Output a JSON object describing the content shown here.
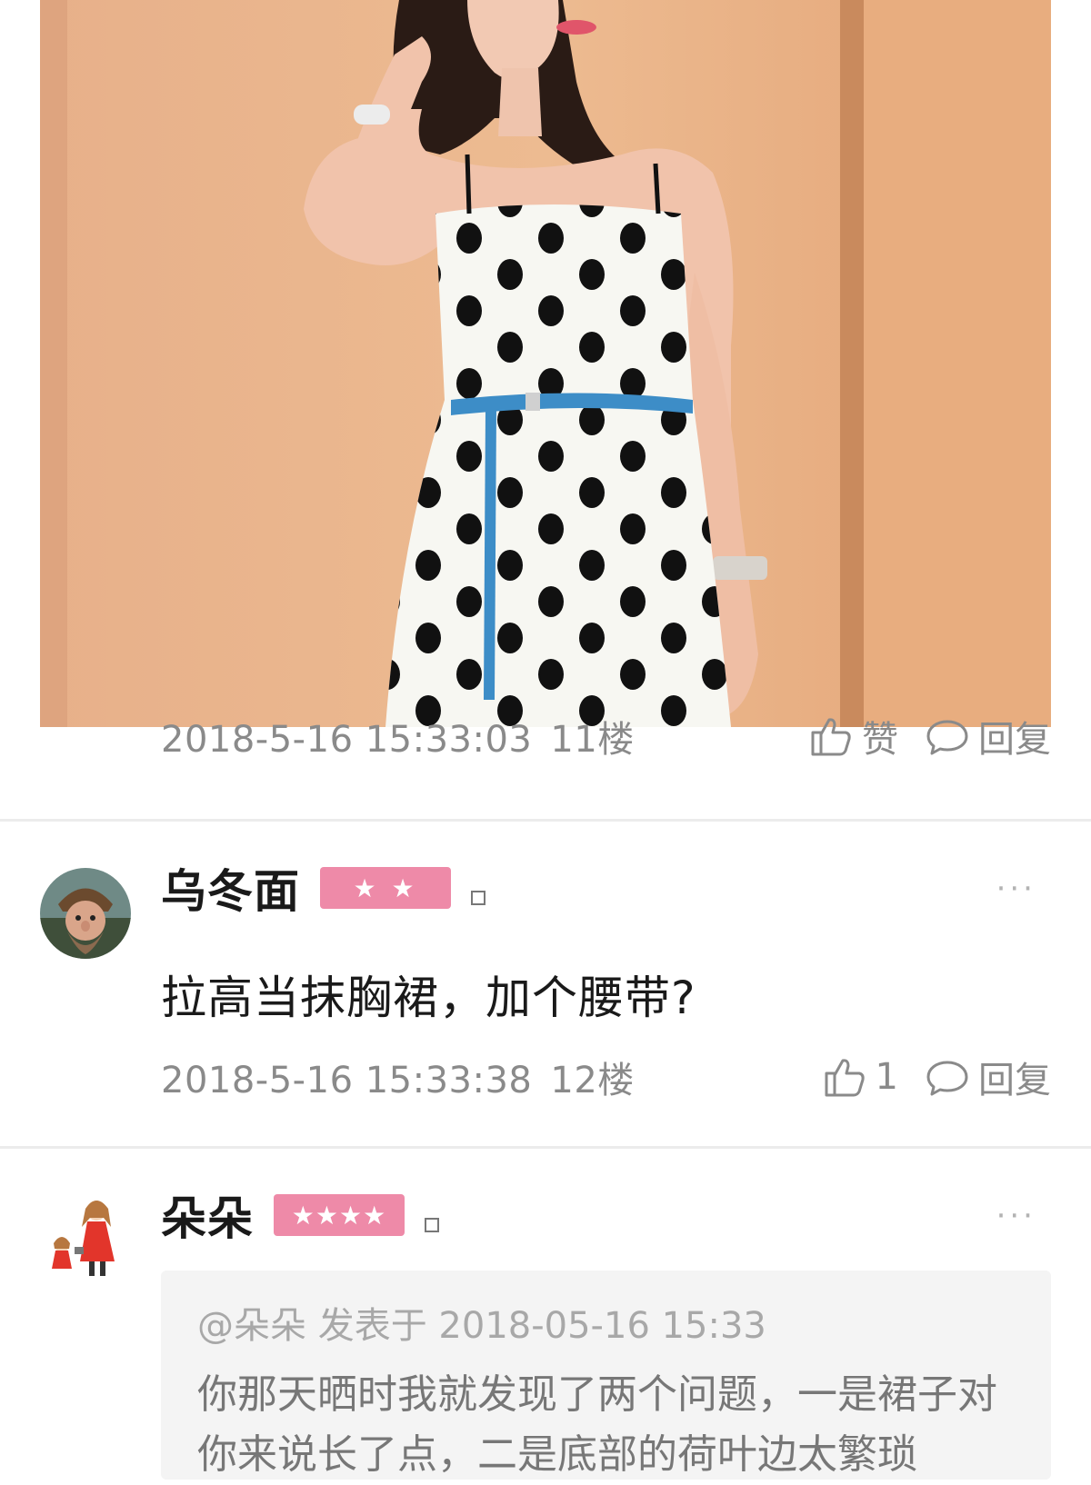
{
  "post_11": {
    "timestamp": "2018-5-16 15:33:03",
    "floor": "11楼",
    "like_label": "赞",
    "reply_label": "回复"
  },
  "comment_12": {
    "username": "乌冬面",
    "level_badge": "★ ★",
    "text": "拉高当抹胸裙，加个腰带?",
    "timestamp": "2018-5-16 15:33:38",
    "floor": "12楼",
    "like_count": "1",
    "reply_label": "回复",
    "more": "···"
  },
  "comment_13": {
    "username": "朵朵",
    "level_badge": "★★★★",
    "more": "···",
    "quote": {
      "header": "@朵朵 发表于 2018-05-16 15:33",
      "body": "你那天晒时我就发现了两个问题，一是裙子对你来说长了点，二是底部的荷叶边太繁琐"
    }
  },
  "colors": {
    "badge_pink": "#ee8aa8",
    "meta_gray": "#8a8a8a",
    "wall_orange": "#e9b48a"
  },
  "icons": [
    "thumbs-up-icon",
    "comment-bubble-icon",
    "more-dots-icon"
  ]
}
